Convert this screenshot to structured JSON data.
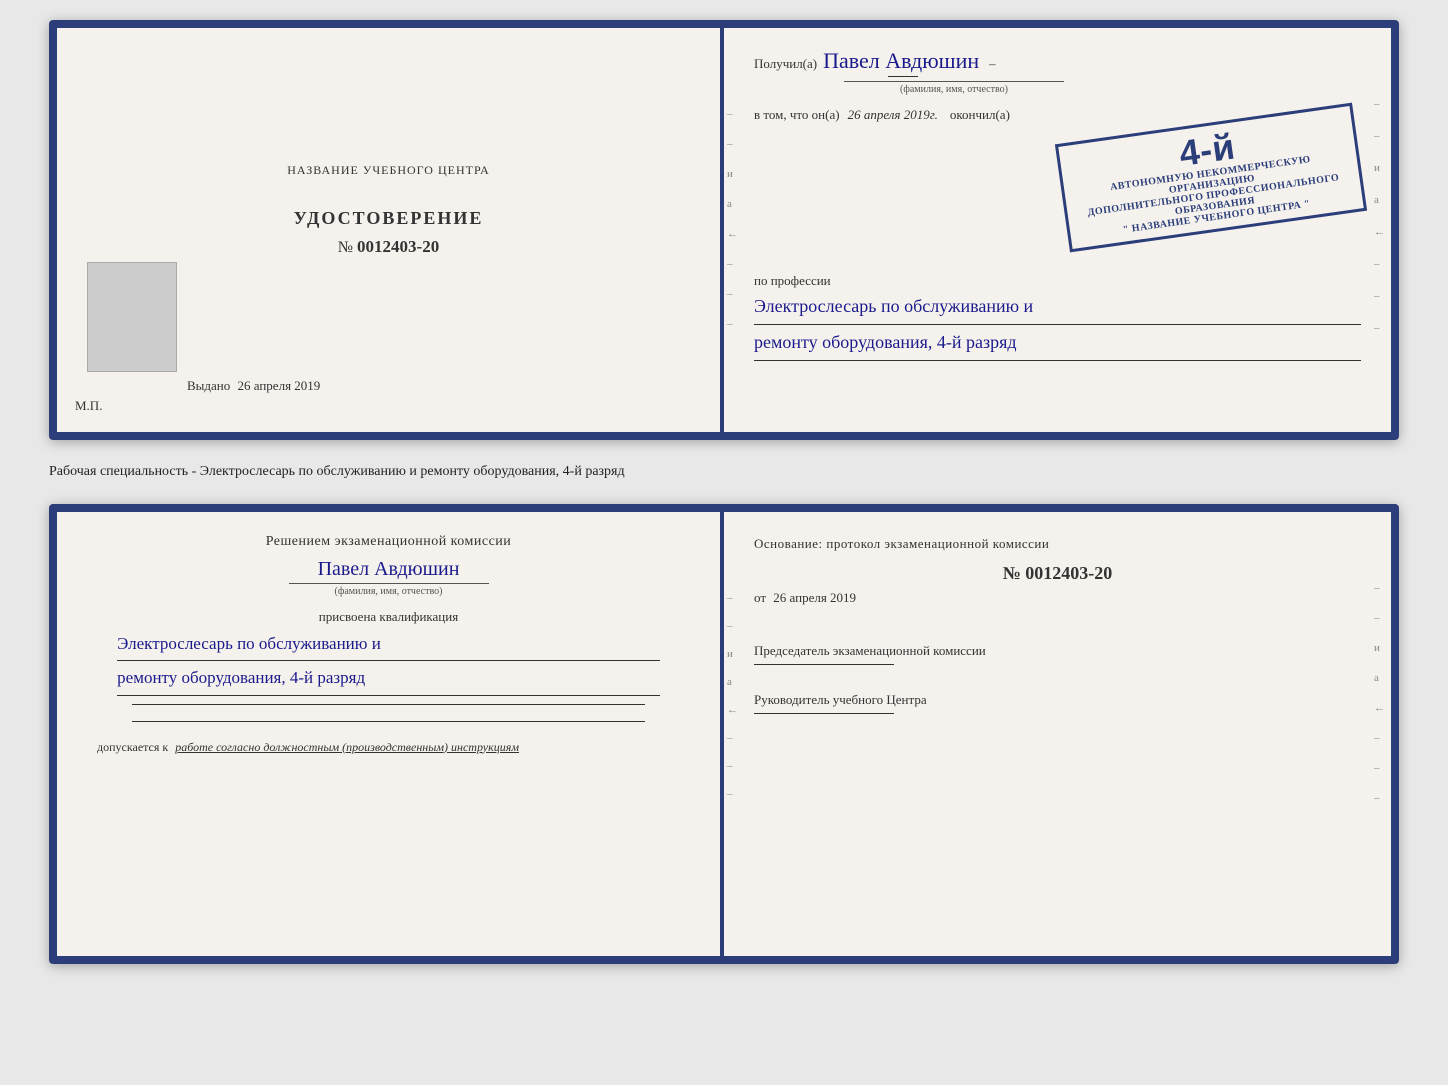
{
  "top_spread": {
    "left": {
      "institution_title": "НАЗВАНИЕ УЧЕБНОГО ЦЕНТРА",
      "cert_label": "УДОСТОВЕРЕНИЕ",
      "cert_number_prefix": "№",
      "cert_number": "0012403-20",
      "issued_label": "Выдано",
      "issued_date": "26 апреля 2019",
      "mp_label": "М.П."
    },
    "right": {
      "received_label": "Получил(а)",
      "recipient_name": "Павел Авдюшин",
      "fio_label": "(фамилия, имя, отчество)",
      "in_that_label": "в том, что он(а)",
      "date_handwritten": "26 апреля 2019г.",
      "finished_label": "окончил(а)",
      "stamp_line1": "АВТОНОМНУЮ НЕКОММЕРЧЕСКУЮ ОРГАНИЗАЦИЮ",
      "stamp_line2": "ДОПОЛНИТЕЛЬНОГО ПРОФЕССИОНАЛЬНОГО ОБРАЗОВАНИЯ",
      "stamp_line3": "\" НАЗВАНИЕ УЧЕБНОГО ЦЕНТРА \"",
      "stamp_grade": "4-й",
      "profession_label": "по профессии",
      "profession_line1": "Электрослесарь по обслуживанию и",
      "profession_line2": "ремонту оборудования, 4-й разряд"
    }
  },
  "middle_caption": {
    "text": "Рабочая специальность - Электрослесарь по обслуживанию и ремонту оборудования, 4-й разряд"
  },
  "bottom_spread": {
    "left": {
      "commission_title": "Решением экзаменационной комиссии",
      "commission_name": "Павел Авдюшин",
      "fio_label": "(фамилия, имя, отчество)",
      "assigned_label": "присвоена квалификация",
      "qualification_line1": "Электрослесарь по обслуживанию и",
      "qualification_line2": "ремонту оборудования, 4-й разряд",
      "admission_label": "допускается к",
      "admission_text": "работе согласно должностным (производственным) инструкциям"
    },
    "right": {
      "basis_label": "Основание: протокол экзаменационной комиссии",
      "basis_number_prefix": "№",
      "basis_number": "0012403-20",
      "basis_date_prefix": "от",
      "basis_date": "26 апреля 2019",
      "chairman_label": "Председатель экзаменационной комиссии",
      "director_label": "Руководитель учебного Центра"
    }
  },
  "right_side_chars": {
    "chars": [
      "–",
      "–",
      "а",
      "←",
      "–",
      "–",
      "–",
      "–"
    ]
  }
}
